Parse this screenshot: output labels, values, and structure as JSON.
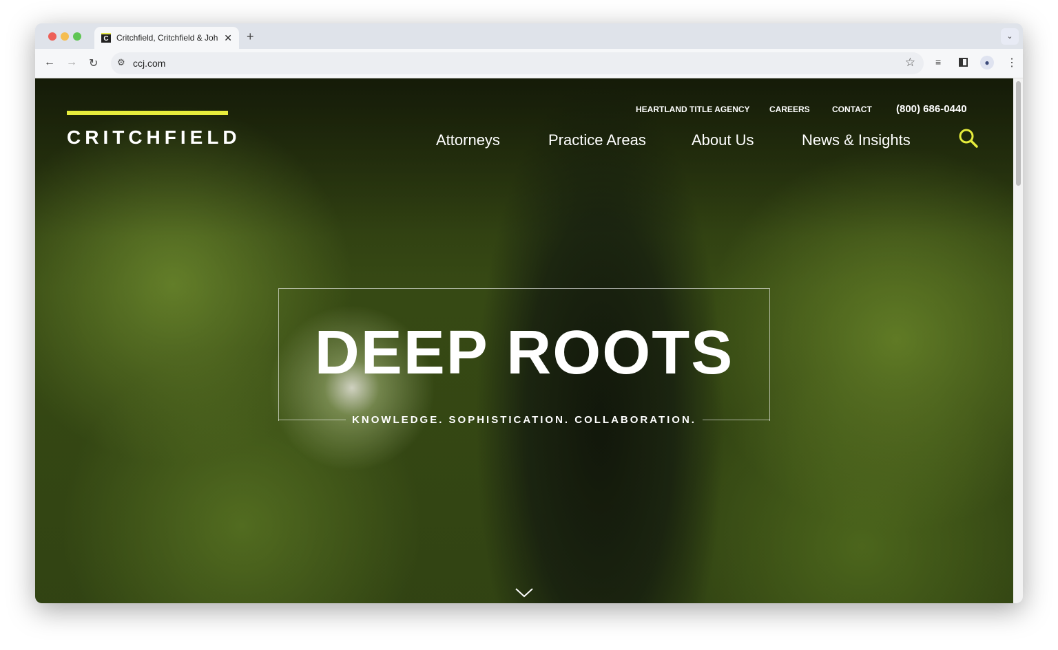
{
  "browser": {
    "tab_title": "Critchfield, Critchfield & Johnston",
    "favicon_letter": "C",
    "url": "ccj.com"
  },
  "site": {
    "logo": "CRITCHFIELD",
    "utility_nav": [
      "HEARTLAND TITLE AGENCY",
      "CAREERS",
      "CONTACT"
    ],
    "phone": "(800) 686-0440",
    "main_nav": [
      "Attorneys",
      "Practice Areas",
      "About Us",
      "News & Insights"
    ],
    "hero_title": "DEEP ROOTS",
    "hero_tagline": "KNOWLEDGE. SOPHISTICATION. COLLABORATION.",
    "accent_color": "#e6ec3c"
  }
}
